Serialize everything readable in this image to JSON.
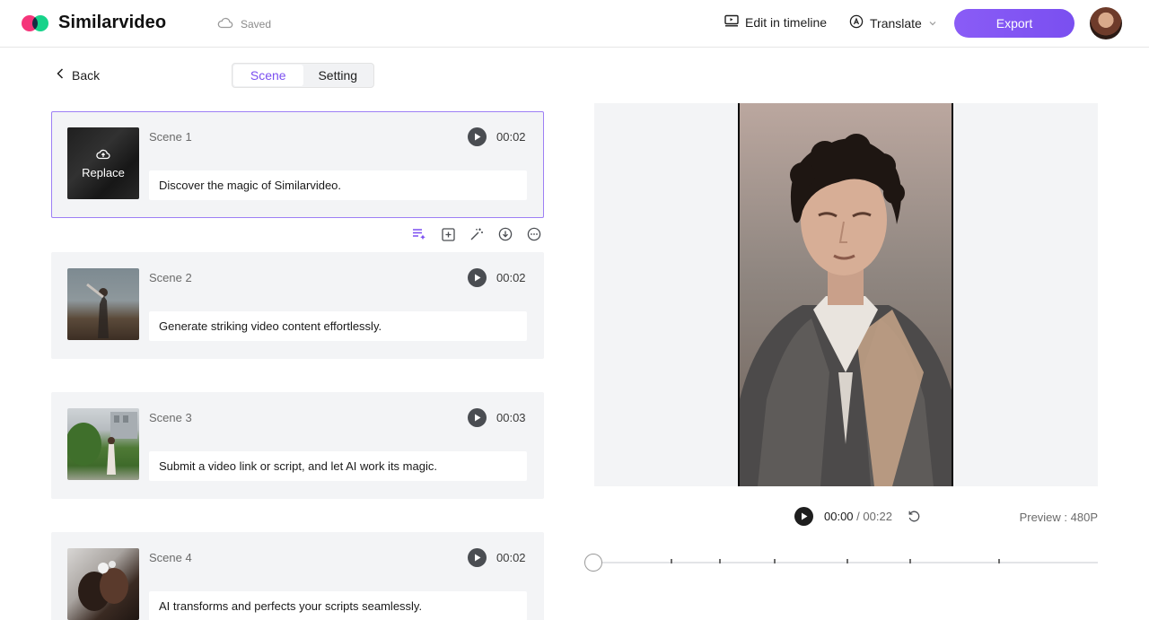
{
  "header": {
    "brand": "Similarvideo",
    "saved": "Saved",
    "edit_in_timeline": "Edit in timeline",
    "translate": "Translate",
    "export": "Export",
    "logo_colors": [
      "#f5357a",
      "#17d38a"
    ],
    "accent": "#7b4ff0"
  },
  "nav": {
    "back": "Back",
    "tabs": [
      {
        "label": "Scene",
        "active": true
      },
      {
        "label": "Setting",
        "active": false
      }
    ]
  },
  "scenes": [
    {
      "label": "Scene 1",
      "duration": "00:02",
      "script": "Discover the magic of Similarvideo.",
      "selected": true,
      "overlay": "Replace"
    },
    {
      "label": "Scene 2",
      "duration": "00:02",
      "script": "Generate striking video content effortlessly.",
      "selected": false
    },
    {
      "label": "Scene 3",
      "duration": "00:03",
      "script": "Submit a video link or script, and let AI work its magic.",
      "selected": false
    },
    {
      "label": "Scene 4",
      "duration": "00:02",
      "script": "AI transforms and perfects your scripts seamlessly.",
      "selected": false
    }
  ],
  "scene_tools": [
    "ai-script-icon",
    "add-scene-icon",
    "magic-wand-icon",
    "download-icon",
    "more-icon"
  ],
  "player": {
    "current": "00:00",
    "separator": " / ",
    "total": "00:22",
    "preview_quality": "Preview : 480P",
    "progress": 0
  }
}
